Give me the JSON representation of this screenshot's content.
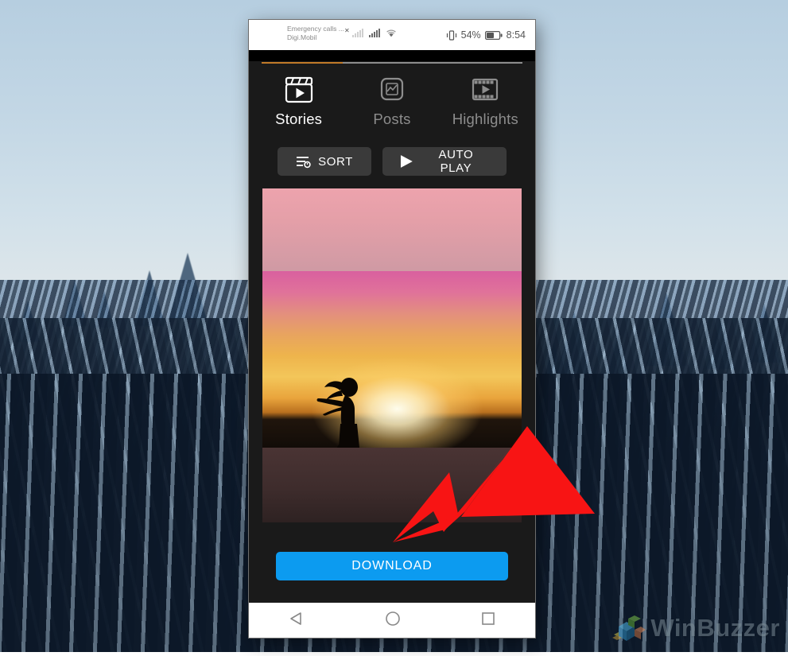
{
  "wallpaper": {
    "description": "snow-covered-pine-forest"
  },
  "phone": {
    "statusbar": {
      "carrier_line1": "Emergency calls ...",
      "carrier_line2": "Digi.Mobil",
      "battery_percent": "54%",
      "clock": "8:54",
      "icons": {
        "no_service": "signal-off-icon",
        "signal": "signal-bars-icon",
        "wifi": "wifi-icon",
        "vibrate": "vibrate-icon",
        "battery": "battery-icon"
      }
    },
    "tabs": [
      {
        "label": "Stories",
        "icon": "clapperboard-play-icon",
        "active": true
      },
      {
        "label": "Posts",
        "icon": "photo-frame-icon",
        "active": false
      },
      {
        "label": "Highlights",
        "icon": "film-strip-play-icon",
        "active": false
      }
    ],
    "actions": [
      {
        "label": "SORT",
        "icon": "sort-icon"
      },
      {
        "label": "AUTO PLAY",
        "icon": "play-icon"
      }
    ],
    "story": {
      "description": "sunset-beach-dancer-silhouette"
    },
    "download": {
      "label": "DOWNLOAD",
      "color": "#0c9bf0"
    },
    "navbar": [
      {
        "name": "back-button",
        "icon": "triangle-left-icon"
      },
      {
        "name": "home-button",
        "icon": "circle-icon"
      },
      {
        "name": "recents-button",
        "icon": "square-icon"
      }
    ]
  },
  "annotation": {
    "arrow_color": "#f81414",
    "points_to": "DOWNLOAD"
  },
  "watermark": {
    "text": "WinBuzzer"
  }
}
